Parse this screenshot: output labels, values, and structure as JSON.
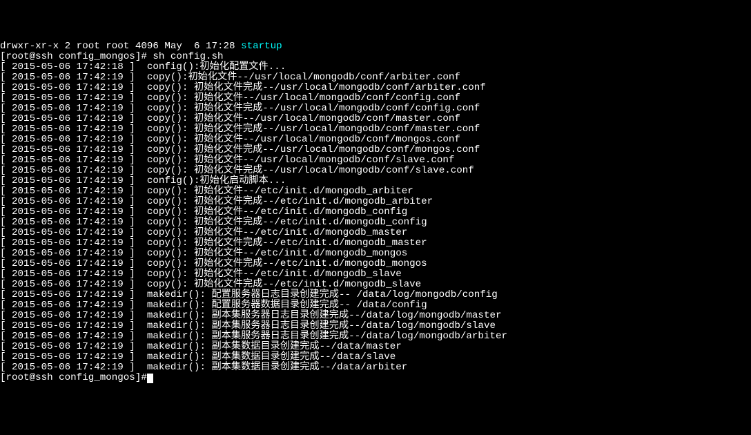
{
  "ls_line": {
    "perm": "drwxr-xr-x 2 root root 4096 May  6 17:28 ",
    "name": "startup"
  },
  "prompt": "[root@ssh config_mongos]# ",
  "command": "sh config.sh",
  "lines": [
    "[ 2015-05-06 17:42:18 ]  config():初始化配置文件...",
    "[ 2015-05-06 17:42:19 ]  copy():初始化文件--/usr/local/mongodb/conf/arbiter.conf",
    "[ 2015-05-06 17:42:19 ]  copy(): 初始化文件完成--/usr/local/mongodb/conf/arbiter.conf",
    "[ 2015-05-06 17:42:19 ]  copy(): 初始化文件--/usr/local/mongodb/conf/config.conf",
    "[ 2015-05-06 17:42:19 ]  copy(): 初始化文件完成--/usr/local/mongodb/conf/config.conf",
    "[ 2015-05-06 17:42:19 ]  copy(): 初始化文件--/usr/local/mongodb/conf/master.conf",
    "[ 2015-05-06 17:42:19 ]  copy(): 初始化文件完成--/usr/local/mongodb/conf/master.conf",
    "[ 2015-05-06 17:42:19 ]  copy(): 初始化文件--/usr/local/mongodb/conf/mongos.conf",
    "[ 2015-05-06 17:42:19 ]  copy(): 初始化文件完成--/usr/local/mongodb/conf/mongos.conf",
    "[ 2015-05-06 17:42:19 ]  copy(): 初始化文件--/usr/local/mongodb/conf/slave.conf",
    "[ 2015-05-06 17:42:19 ]  copy(): 初始化文件完成--/usr/local/mongodb/conf/slave.conf",
    "[ 2015-05-06 17:42:19 ]  config():初始化启动脚本...",
    "[ 2015-05-06 17:42:19 ]  copy(): 初始化文件--/etc/init.d/mongodb_arbiter",
    "[ 2015-05-06 17:42:19 ]  copy(): 初始化文件完成--/etc/init.d/mongodb_arbiter",
    "[ 2015-05-06 17:42:19 ]  copy(): 初始化文件--/etc/init.d/mongodb_config",
    "[ 2015-05-06 17:42:19 ]  copy(): 初始化文件完成--/etc/init.d/mongodb_config",
    "[ 2015-05-06 17:42:19 ]  copy(): 初始化文件--/etc/init.d/mongodb_master",
    "[ 2015-05-06 17:42:19 ]  copy(): 初始化文件完成--/etc/init.d/mongodb_master",
    "[ 2015-05-06 17:42:19 ]  copy(): 初始化文件--/etc/init.d/mongodb_mongos",
    "[ 2015-05-06 17:42:19 ]  copy(): 初始化文件完成--/etc/init.d/mongodb_mongos",
    "[ 2015-05-06 17:42:19 ]  copy(): 初始化文件--/etc/init.d/mongodb_slave",
    "[ 2015-05-06 17:42:19 ]  copy(): 初始化文件完成--/etc/init.d/mongodb_slave",
    "[ 2015-05-06 17:42:19 ]  makedir(): 配置服务器日志目录创建完成-- /data/log/mongodb/config",
    "[ 2015-05-06 17:42:19 ]  makedir(): 配置服务器数据目录创建完成-- /data/config",
    "[ 2015-05-06 17:42:19 ]  makedir(): 副本集服务器日志目录创建完成--/data/log/mongodb/master",
    "[ 2015-05-06 17:42:19 ]  makedir(): 副本集服务器日志目录创建完成--/data/log/mongodb/slave",
    "[ 2015-05-06 17:42:19 ]  makedir(): 副本集服务器日志目录创建完成--/data/log/mongodb/arbiter",
    "[ 2015-05-06 17:42:19 ]  makedir(): 副本集数据目录创建完成--/data/master",
    "[ 2015-05-06 17:42:19 ]  makedir(): 副本集数据目录创建完成--/data/slave",
    "[ 2015-05-06 17:42:19 ]  makedir(): 副本集数据目录创建完成--/data/arbiter"
  ],
  "prompt2": "[root@ssh config_mongos]#"
}
